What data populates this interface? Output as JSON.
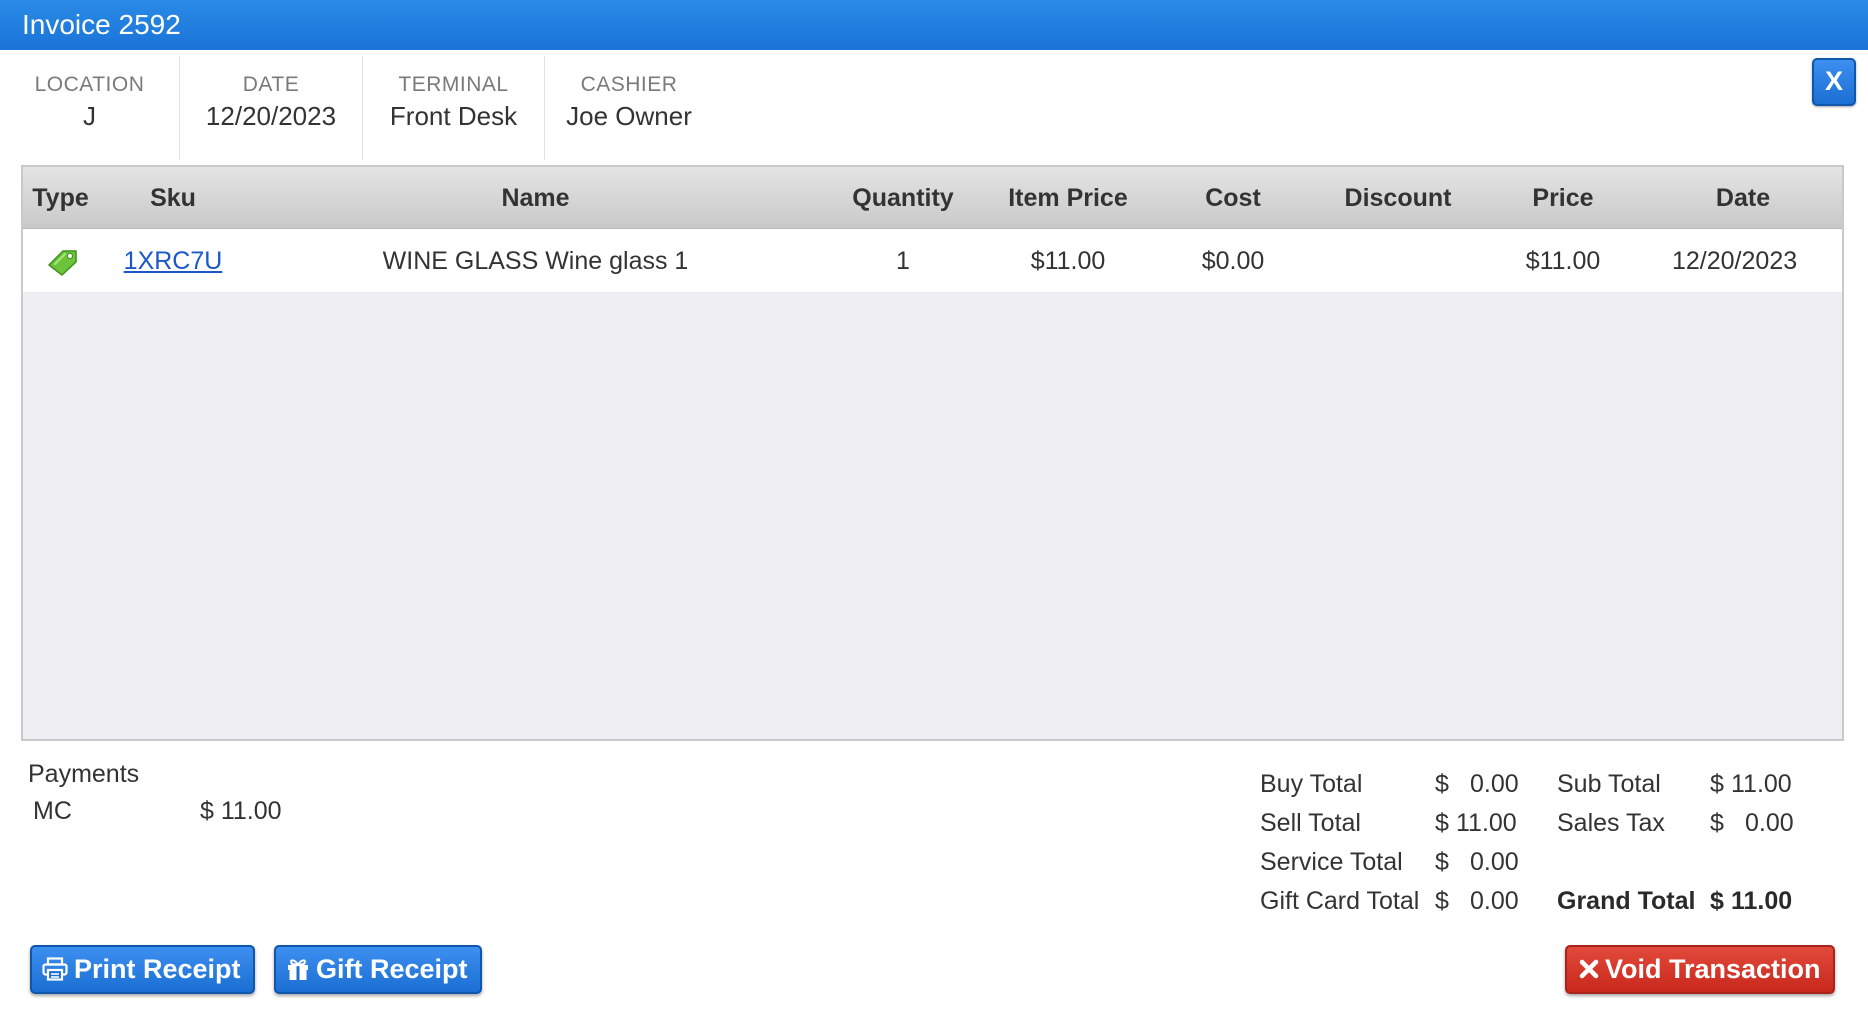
{
  "window": {
    "title": "Invoice 2592",
    "close_label": "X"
  },
  "meta": {
    "location": {
      "label": "LOCATION",
      "value": "J"
    },
    "date": {
      "label": "DATE",
      "value": "12/20/2023"
    },
    "terminal": {
      "label": "TERMINAL",
      "value": "Front Desk"
    },
    "cashier": {
      "label": "CASHIER",
      "value": "Joe Owner"
    }
  },
  "table": {
    "columns": [
      "Type",
      "Sku",
      "Name",
      "Quantity",
      "Item Price",
      "Cost",
      "Discount",
      "Price",
      "Date"
    ],
    "rows": [
      {
        "type_icon": "tag-icon",
        "sku": "1XRC7U",
        "name": "WINE GLASS Wine glass 1",
        "quantity": "1",
        "item_price": "$11.00",
        "cost": "$0.00",
        "discount": "",
        "price": "$11.00",
        "date": "12/20/2023"
      }
    ]
  },
  "payments": {
    "title": "Payments",
    "items": [
      {
        "method": "MC",
        "amount": "$ 11.00"
      }
    ]
  },
  "totals": {
    "buy": {
      "label": "Buy Total",
      "currency": "$",
      "amount": "0.00"
    },
    "sell": {
      "label": "Sell Total",
      "currency": "$",
      "amount": "11.00"
    },
    "service": {
      "label": "Service Total",
      "currency": "$",
      "amount": "0.00"
    },
    "gift_card": {
      "label": "Gift Card Total",
      "currency": "$",
      "amount": "0.00"
    },
    "sub": {
      "label": "Sub Total",
      "currency": "$",
      "amount": "11.00"
    },
    "tax": {
      "label": "Sales Tax",
      "currency": "$",
      "amount": "0.00"
    },
    "grand": {
      "label": "Grand Total",
      "currency": "$",
      "amount": "11.00"
    }
  },
  "buttons": {
    "print_receipt": {
      "label": "Print Receipt",
      "icon": "printer-icon"
    },
    "gift_receipt": {
      "label": "Gift Receipt",
      "icon": "gift-icon"
    },
    "void": {
      "label": "Void Transaction",
      "icon": "x-icon"
    }
  },
  "colors": {
    "titlebar": "#1a74d8",
    "primary_button": "#1a6fd2",
    "danger_button": "#c8281b",
    "link": "#1a57c9",
    "tag": "#6cc43a"
  }
}
